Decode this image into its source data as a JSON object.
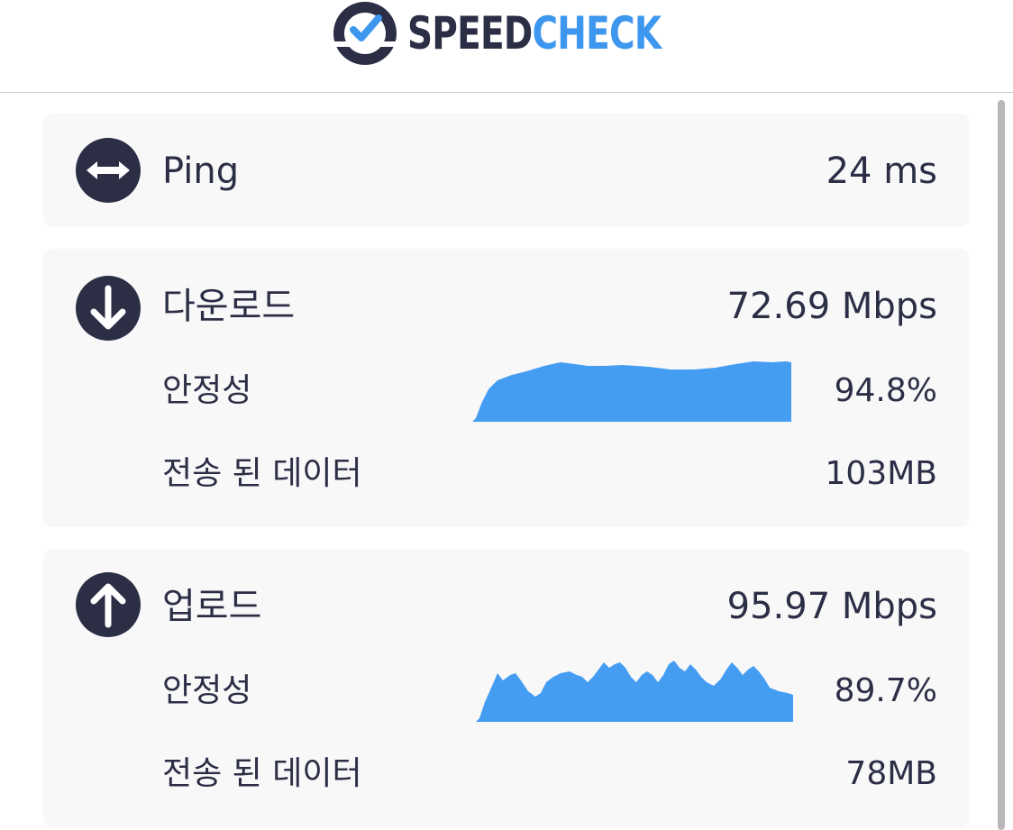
{
  "header": {
    "logo_part1": "SPEED",
    "logo_part2": "CHECK",
    "brand_color_dark": "#2b2e45",
    "brand_color_blue": "#3d97ee"
  },
  "ping": {
    "icon": "left-right-arrow-icon",
    "label": "Ping",
    "value": "24 ms"
  },
  "download": {
    "icon": "down-arrow-icon",
    "label": "다운로드",
    "value": "72.69 Mbps",
    "stability_label": "안정성",
    "stability_value": "94.8%",
    "data_label": "전송 된 데이터",
    "data_value": "103MB",
    "chart_color": "#459df2"
  },
  "upload": {
    "icon": "up-arrow-icon",
    "label": "업로드",
    "value": "95.97 Mbps",
    "stability_label": "안정성",
    "stability_value": "89.7%",
    "data_label": "전송 된 데이터",
    "data_value": "78MB",
    "chart_color": "#459df2"
  }
}
